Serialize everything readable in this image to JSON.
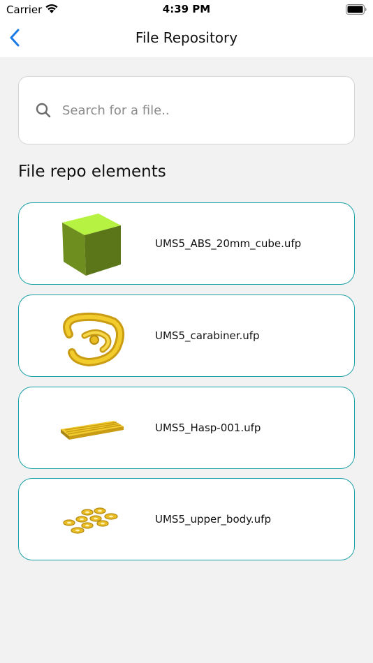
{
  "status_bar": {
    "carrier": "Carrier",
    "time": "4:39 PM"
  },
  "nav": {
    "title": "File Repository",
    "back_icon": "chevron-left-icon"
  },
  "search": {
    "placeholder": "Search for a file..",
    "value": "",
    "icon": "search-icon"
  },
  "section_title": "File repo elements",
  "accent_color": "#1aa1a6",
  "files": [
    {
      "name": "UMS5_ABS_20mm_cube.ufp",
      "thumb_icon": "cube-model-icon"
    },
    {
      "name": "UMS5_carabiner.ufp",
      "thumb_icon": "carabiner-model-icon"
    },
    {
      "name": "UMS5_Hasp-001.ufp",
      "thumb_icon": "hasp-model-icon"
    },
    {
      "name": "UMS5_upper_body.ufp",
      "thumb_icon": "upper-body-parts-model-icon"
    }
  ]
}
